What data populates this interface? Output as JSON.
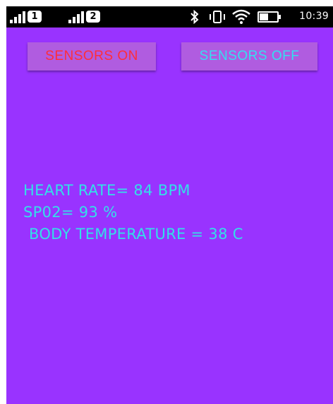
{
  "status_bar": {
    "sim1_label": "1",
    "sim2_label": "2",
    "time": "10:39",
    "icons": [
      "signal-icon",
      "signal-icon",
      "bluetooth-icon",
      "vibrate-icon",
      "wifi-icon",
      "battery-icon"
    ]
  },
  "controls": {
    "sensors_on_label": "SENSORS ON",
    "sensors_off_label": "SENSORS OFF",
    "sensors_on_color": "#ff2d3a",
    "sensors_off_color": "#33e0f0"
  },
  "readings": {
    "heart_rate": "HEART RATE= 84 BPM",
    "spo2": "SP02= 93 %",
    "body_temperature": " BODY TEMPERATURE = 38 C"
  },
  "colors": {
    "background": "#9933ff",
    "reading_text": "#33e0e8"
  }
}
